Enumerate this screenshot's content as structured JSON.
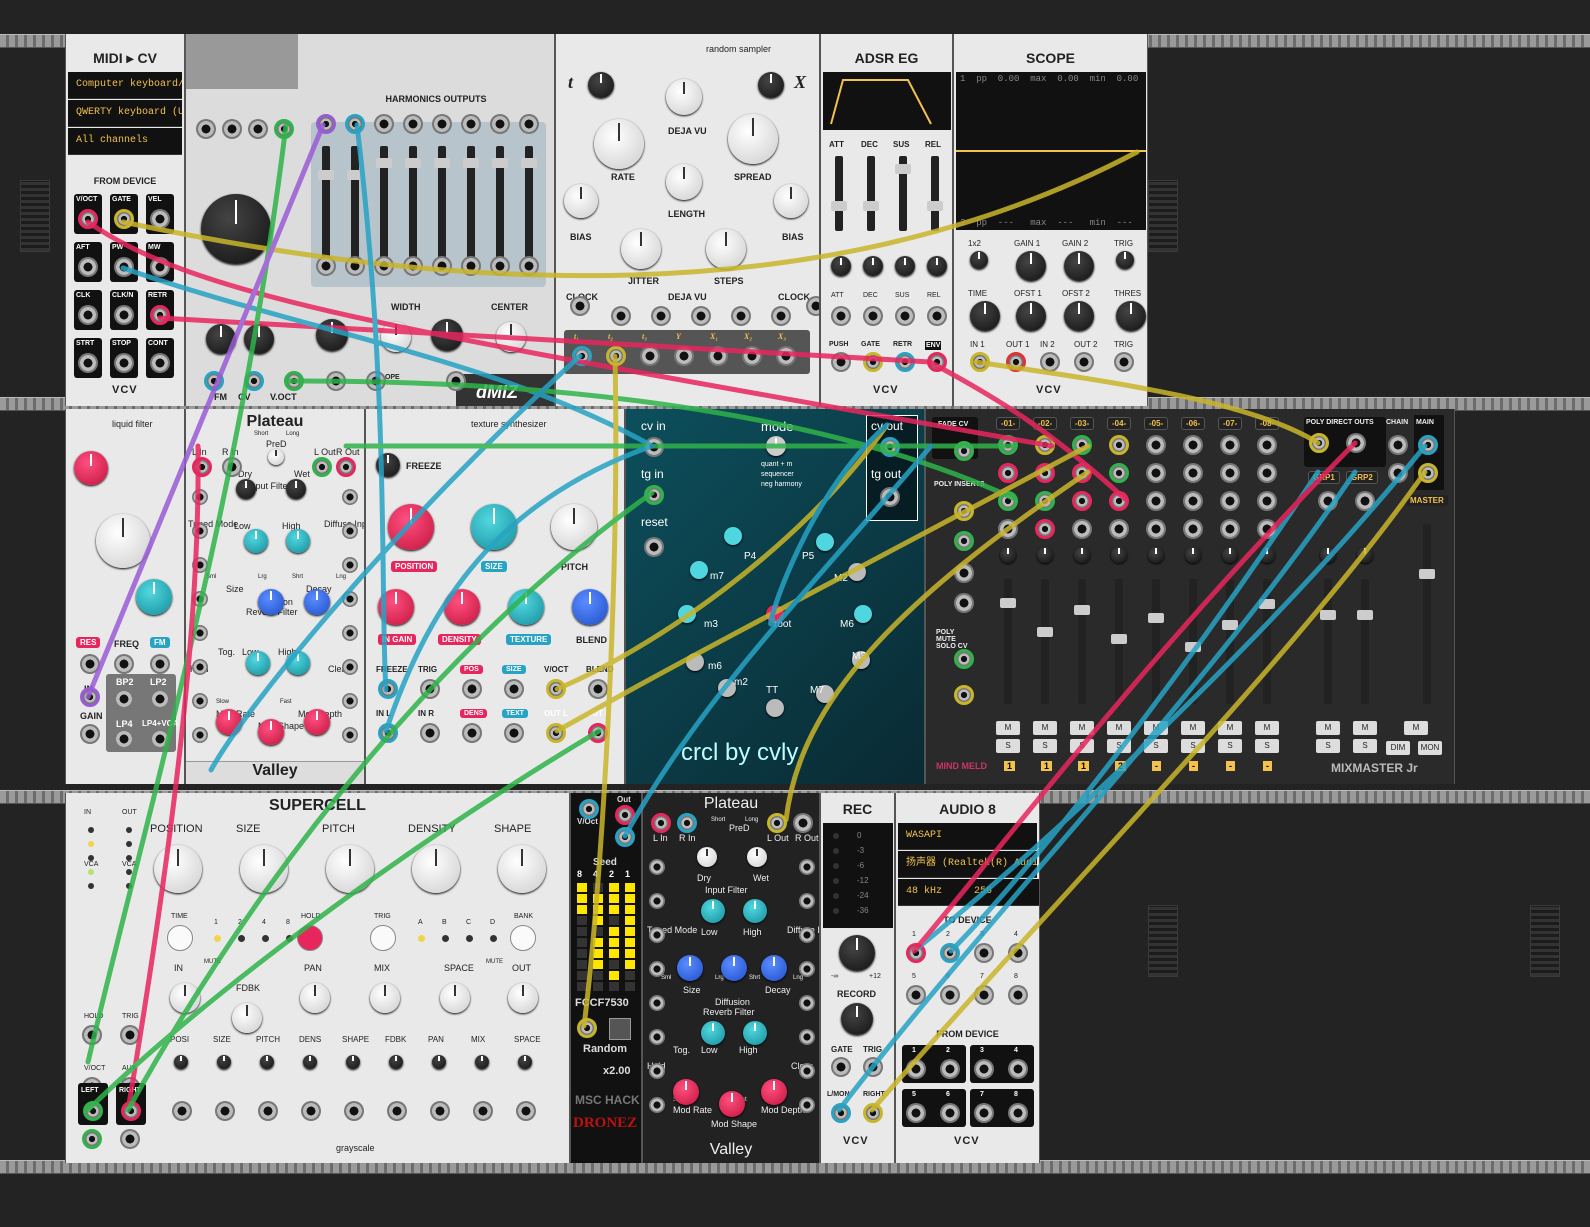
{
  "midi_cv": {
    "title": "MIDI ▸ CV",
    "driver": "Computer keyboard/mouse",
    "device": "QWERTY keyboard (US)",
    "channel": "All channels",
    "section": "FROM DEVICE",
    "jacks": [
      "V/OCT",
      "GATE",
      "VEL",
      "AFT",
      "PW",
      "MW",
      "CLK",
      "CLK/N",
      "RETR",
      "STRT",
      "STOP",
      "CONT"
    ],
    "brand": "VCV"
  },
  "harmonics": {
    "outputs_title": "HARMONICS OUTPUTS",
    "labels": [
      "WIDTH",
      "CENTER",
      "FM",
      "CV",
      "V.OCT",
      "SLOPE"
    ],
    "brand": "dMIZ"
  },
  "random_sampler": {
    "title": "random sampler",
    "t": "t",
    "x": "X",
    "labels": [
      "DEJA VU",
      "RATE",
      "SPREAD",
      "BIAS",
      "BIAS",
      "LENGTH",
      "JITTER",
      "STEPS",
      "DEJA VU",
      "CLOCK",
      "CLOCK"
    ],
    "outputs": [
      "t₁",
      "t₂",
      "t₃",
      "Y",
      "X₁",
      "X₂",
      "X₃"
    ]
  },
  "adsr": {
    "title": "ADSR EG",
    "labels": [
      "ATT",
      "DEC",
      "SUS",
      "REL"
    ],
    "buttons": [
      "PUSH",
      "GATE",
      "RETR",
      "ENV"
    ],
    "brand": "VCV"
  },
  "scope": {
    "title": "SCOPE",
    "readout_top": "1  pp  0.00  max  0.00  min  0.00",
    "readout_bottom": "2  pp  ---   max  ---   min  ---",
    "labels": [
      "1x2",
      "GAIN 1",
      "GAIN 2",
      "TRIG",
      "TIME",
      "OFST 1",
      "OFST 2",
      "THRES",
      "IN 1",
      "OUT 1",
      "IN 2",
      "OUT 2",
      "TRIG"
    ],
    "brand": "VCV"
  },
  "liquid_filter": {
    "title": "liquid filter",
    "labels": [
      "RES",
      "FREQ",
      "FM",
      "IN",
      "BP2",
      "LP2",
      "GAIN",
      "LP4",
      "LP4+VCA"
    ]
  },
  "plateau1": {
    "title": "Plateau",
    "footer": "Valley",
    "labels": [
      "L In",
      "R In",
      "PreD",
      "Short",
      "Long",
      "L Out",
      "R Out",
      "Dry",
      "Wet",
      "Input Filter",
      "Low",
      "High",
      "Tuned Mode",
      "Diffuse Input",
      "Size",
      "Sml",
      "Lrg",
      "Decay",
      "Shrt",
      "Lng",
      "Diffusion",
      "Reverb Filter",
      "Tog.",
      "Low",
      "High",
      "Hold",
      "Clear",
      "Mod Rate",
      "Mod Shape",
      "Mod Depth",
      "Slow",
      "Fast"
    ]
  },
  "texture": {
    "title": "texture synthesizer",
    "freeze": "FREEZE",
    "tags": [
      "POSITION",
      "SIZE",
      "PITCH",
      "IN GAIN",
      "DENSITY",
      "TEXTURE",
      "BLEND"
    ],
    "jacks": [
      "FREEZE",
      "TRIG",
      "POS",
      "SIZE",
      "V/OCT",
      "BLEND",
      "IN L",
      "IN R",
      "DENS",
      "TEXT",
      "OUT L",
      "OUT R"
    ]
  },
  "crcl": {
    "labels": [
      "cv in",
      "tg in",
      "reset",
      "mode",
      "cv out",
      "tg out"
    ],
    "modes": [
      "quant + m",
      "sequencer",
      "neg harmony"
    ],
    "notes": [
      "P4",
      "P5",
      "m7",
      "M2",
      "m3",
      "root",
      "M6",
      "m6",
      "M3",
      "m2",
      "M7",
      "TT"
    ],
    "brand": "crcl by cvly"
  },
  "mixmaster": {
    "channels": [
      "-01-",
      "-02-",
      "-03-",
      "-04-",
      "-05-",
      "-06-",
      "-07-",
      "-08-"
    ],
    "fade": "FADE CV",
    "poly_inserts": "POLY INSERTS",
    "poly_mute": "POLY MUTE SOLO CV",
    "direct": "POLY DIRECT OUTS",
    "direct_labels": [
      "1-8",
      "Grp/Aux"
    ],
    "groups": [
      "GRP1",
      "GRP2"
    ],
    "chain": "CHAIN",
    "main": "MAIN",
    "master": "MASTER",
    "buttons": [
      "M",
      "S",
      "DIM",
      "MON"
    ],
    "brand": "MIXMASTER Jr",
    "maker": "MIND MELD",
    "track_values": [
      "1",
      "1",
      "1",
      "2",
      "-",
      "-",
      "-",
      "-"
    ]
  },
  "supercell": {
    "title": "SUPERCELL",
    "knobs": [
      "POSITION",
      "SIZE",
      "PITCH",
      "DENSITY",
      "SHAPE"
    ],
    "row2": [
      "TIME",
      "HOLD",
      "TRIG",
      "BANK"
    ],
    "steps": [
      "1",
      "2",
      "4",
      "8",
      "A",
      "B",
      "C",
      "D"
    ],
    "row3": [
      "IN",
      "FDBK",
      "PAN",
      "MIX",
      "SPACE",
      "OUT",
      "MUTE",
      "MUTE"
    ],
    "left_jacks": [
      "IN",
      "OUT",
      "VCA",
      "VCA",
      "HOLD",
      "TRIG",
      "V/OCT",
      "AUX",
      "LEFT",
      "RIGHT"
    ],
    "cv": [
      "POSI",
      "SIZE",
      "PITCH",
      "DENS",
      "SHAPE",
      "FDBK",
      "PAN",
      "MIX",
      "SPACE"
    ],
    "out": [
      "LEFT",
      "RIGHT"
    ],
    "brand": "grayscale"
  },
  "dronez": {
    "labels": [
      "V/Oct",
      "Out",
      "Seed"
    ],
    "bits": [
      "8",
      "4",
      "2",
      "1"
    ],
    "seed": "FCCF7530",
    "random": "Random",
    "mult": "x2.00",
    "brand": "MSC HACK",
    "name": "DRONEZ"
  },
  "plateau2": {
    "title": "Plateau",
    "footer": "Valley"
  },
  "rec": {
    "title": "REC",
    "levels": [
      "0",
      "-3",
      "-6",
      "-12",
      "-24",
      "-36"
    ],
    "record": "RECORD",
    "jacks": [
      "GATE",
      "TRIG",
      "L/MON",
      "RIGHT"
    ],
    "range": [
      "-∞",
      "+12"
    ],
    "brand": "VCV"
  },
  "audio8": {
    "title": "AUDIO 8",
    "driver": "WASAPI",
    "device": "扬声器 (Realtek(R) Audio)",
    "rate": "48 kHz",
    "block": "256",
    "to_device": "TO DEVICE",
    "from_device": "FROM DEVICE",
    "nums": [
      "1",
      "2",
      "3",
      "4",
      "5",
      "6",
      "7",
      "8"
    ],
    "brand": "VCV"
  },
  "cable_colors": {
    "pink": "#e8265e",
    "teal": "#27a3c4",
    "green": "#2fb34a",
    "yellow": "#c9b52a",
    "purple": "#9a5bd6"
  }
}
